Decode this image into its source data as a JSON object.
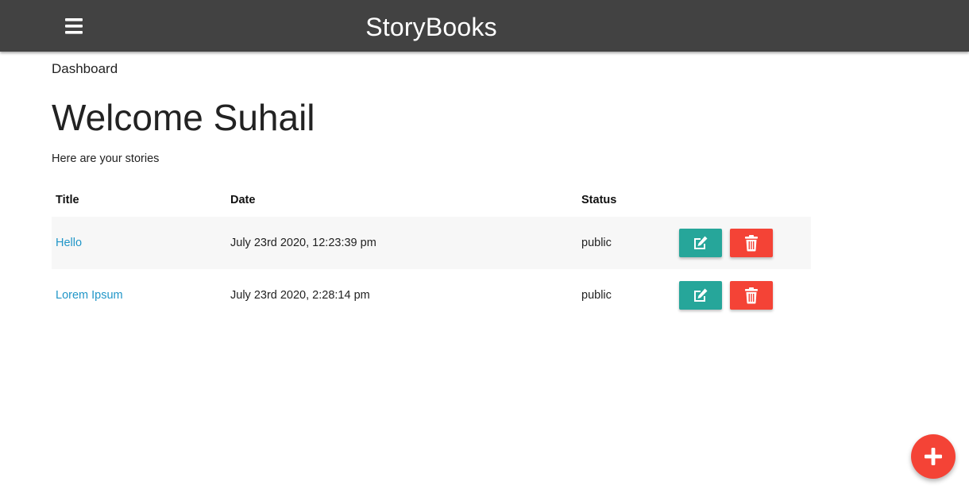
{
  "navbar": {
    "brand": "StoryBooks",
    "menu_icon": "hamburger-menu-icon",
    "background": "#424242"
  },
  "breadcrumb": "Dashboard",
  "welcome": "Welcome Suhail",
  "subtitle": "Here are your stories",
  "table": {
    "headers": {
      "title": "Title",
      "date": "Date",
      "status": "Status"
    },
    "rows": [
      {
        "title": "Hello",
        "date": "July 23rd 2020, 12:23:39 pm",
        "status": "public"
      },
      {
        "title": "Lorem Ipsum",
        "date": "July 23rd 2020, 2:28:14 pm",
        "status": "public"
      }
    ]
  },
  "icons": {
    "edit": "edit-icon",
    "delete": "trash-icon",
    "add": "plus-icon"
  },
  "colors": {
    "link": "#2196c8",
    "edit_button": "#26a69a",
    "delete_button": "#f44336",
    "fab": "#f44336"
  }
}
